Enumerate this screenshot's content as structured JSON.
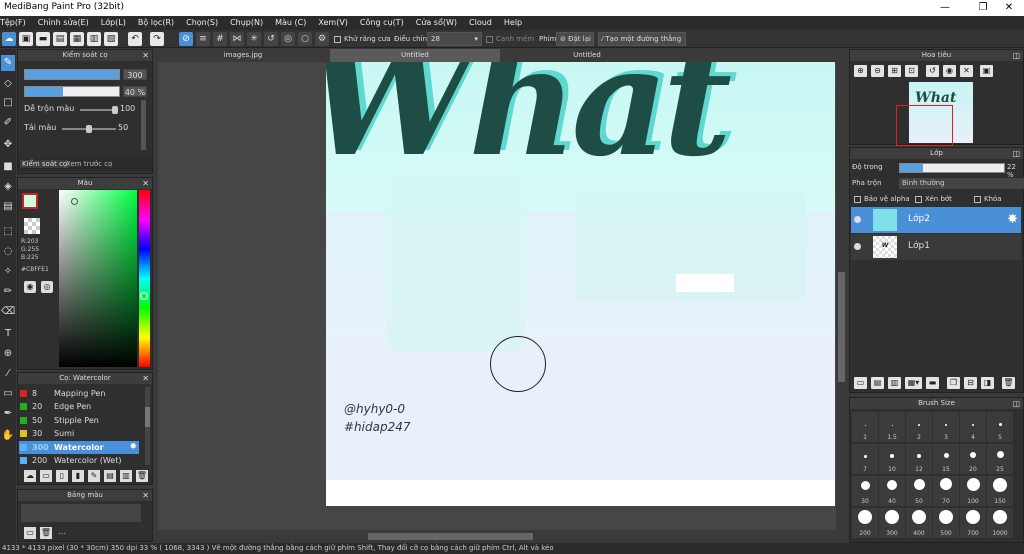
{
  "window": {
    "title": "MediBang Paint Pro (32bit)",
    "min_icon": "—",
    "max_icon": "❐",
    "close_icon": "✕"
  },
  "menu": [
    "Tệp(F)",
    "Chỉnh sửa(E)",
    "Lớp(L)",
    "Bộ lọc(R)",
    "Chọn(S)",
    "Chụp(N)",
    "Màu (C)",
    "Xem(V)",
    "Công cụ(T)",
    "Cửa sổ(W)",
    "Cloud",
    "Help"
  ],
  "toolbar": {
    "antialias_label": "Khử răng cưa",
    "adjust_label": "Điều chỉnh",
    "adjust_value": "28",
    "soft_edge_label": "Cạnh mềm",
    "key_label": "Phím",
    "reset_label": "Đặt lại",
    "new_line_label": "Tạo một đường thẳng"
  },
  "brush_control": {
    "title": "Kiểm soát cọ",
    "size_value": "300",
    "opacity_value": "40 %",
    "opacity_fraction": 0.4,
    "blend_label": "Dễ trộn màu",
    "blend_value": "100",
    "blend_fraction": 1.0,
    "amount_label": "Tải màu",
    "amount_value": "50",
    "amount_fraction": 0.5,
    "tabs": [
      "Kiểm soát cọ",
      "Xem trước cọ"
    ]
  },
  "color_panel": {
    "title": "Màu",
    "r": "R:203",
    "g": "G:255",
    "b": "B:225",
    "hex": "#CBFFE1",
    "fg_color": "#cbffe1",
    "hue_color": "#00ff44"
  },
  "brush_panel": {
    "title": "Cọ: Watercolor",
    "items": [
      {
        "size": "8",
        "name": "Mapping Pen",
        "color": "#e02020"
      },
      {
        "size": "20",
        "name": "Edge Pen",
        "color": "#20b020"
      },
      {
        "size": "50",
        "name": "Stipple Pen",
        "color": "#20b020"
      },
      {
        "size": "30",
        "name": "Sumi",
        "color": "#e0c020"
      },
      {
        "size": "300",
        "name": "Watercolor",
        "color": "#5ab0ff"
      },
      {
        "size": "200",
        "name": "Watercolor (Wet)",
        "color": "#5ab0ff"
      }
    ]
  },
  "palette_panel": {
    "title": "Bảng màu"
  },
  "doc_tabs": [
    "images.jpg",
    "Untitled",
    "Untitled"
  ],
  "canvas": {
    "word": "What",
    "sig_line1": "@hyhy0-0",
    "sig_line2": "#hidap247"
  },
  "navigator": {
    "title": "Hoa tiêu",
    "thumb_text": "What"
  },
  "layer_panel": {
    "title": "Lớp",
    "opacity_label": "Độ trong",
    "opacity_value": "22 %",
    "opacity_fraction": 0.22,
    "blend_label": "Pha trộn",
    "blend_value": "Bình thường",
    "protect_alpha": "Bảo vệ alpha",
    "clipping": "Xén bớt",
    "lock": "Khóa",
    "layers": [
      {
        "name": "Lớp2",
        "selected": true
      },
      {
        "name": "Lớp1",
        "selected": false
      }
    ]
  },
  "brush_size": {
    "title": "Brush Size",
    "rows": [
      [
        "1",
        "1.5",
        "2",
        "3",
        "4",
        "5"
      ],
      [
        "7",
        "10",
        "12",
        "15",
        "20",
        "25"
      ],
      [
        "30",
        "40",
        "50",
        "70",
        "100",
        "150"
      ],
      [
        "200",
        "300",
        "400",
        "500",
        "700",
        "1000"
      ]
    ]
  },
  "status": "4133 * 4133 pixel   (30 * 30cm)   350 dpi   33 %   ( 1068, 3343 )   Vẽ một đường thẳng bằng cách giữ phím Shift, Thay đổi cỡ cọ bằng cách giữ phím Ctrl, Alt và kéo"
}
